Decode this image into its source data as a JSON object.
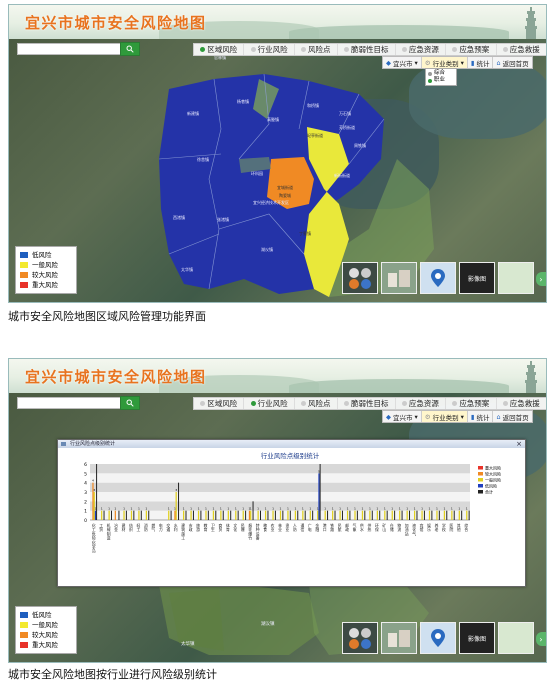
{
  "app": {
    "title": "宜兴市城市安全风险地图",
    "search_placeholder": "",
    "nav_tabs": [
      "区域风险",
      "行业风险",
      "风险点",
      "脆弱性目标",
      "应急资源",
      "应急预案",
      "应急救援"
    ],
    "toolbar": {
      "city": "宜兴市",
      "industry": "行业类别",
      "stats": "统计",
      "home": "返回首页"
    },
    "industry_dropdown": [
      "综合",
      "职业"
    ],
    "legend": [
      {
        "label": "低风险",
        "color": "#1f5fbf"
      },
      {
        "label": "一般风险",
        "color": "#f3e92f"
      },
      {
        "label": "较大风险",
        "color": "#f08a24"
      },
      {
        "label": "重大风险",
        "color": "#e8332a"
      }
    ],
    "thumbnails": [
      "",
      "",
      "",
      "影像图",
      ""
    ]
  },
  "panel1": {
    "active_tab": "区域风险",
    "caption": "城市安全风险地图区域风险管理功能界面",
    "regions": [
      "官林镇",
      "新建镇",
      "杨巷镇",
      "和桥镇",
      "万石镇",
      "周铁镇",
      "芳桥街道",
      "新街街道",
      "宜城街道",
      "屺亭街道",
      "宜兴经济技术开发区",
      "高塍镇",
      "丁蜀镇",
      "湖㳇镇",
      "张渚镇",
      "西渚镇",
      "太华镇",
      "徐舍镇",
      "环科园",
      "陶瓷城"
    ]
  },
  "panel2": {
    "active_tab": "行业风险",
    "caption": "城市安全风险地图按行业进行风险级别统计",
    "window_title": "行业风险点级别统计",
    "map_labels": [
      "湖㳇镇",
      "太华镇"
    ],
    "chart_data": {
      "type": "bar",
      "title": "行业风险点级别统计",
      "series_legend": [
        "重大风险",
        "较大风险",
        "一般风险",
        "低风险",
        "合计"
      ],
      "series_colors": [
        "#e8332a",
        "#f08a24",
        "#e0d020",
        "#1f3fbf",
        "#222222"
      ],
      "categories": [
        "化工危险化学品",
        "工贸",
        "机械制造",
        "冶金",
        "建材",
        "纺织",
        "轻工",
        "消防",
        "燃气",
        "电力",
        "交通",
        "水利",
        "建筑施工",
        "市政",
        "旅游",
        "教育",
        "卫生",
        "商贸",
        "体育",
        "文化",
        "民爆",
        "烟花爆竹",
        "特种设备",
        "粮食",
        "农业",
        "林业",
        "渔业",
        "人防",
        "通信",
        "广电",
        "金融",
        "港口",
        "铁路",
        "民航",
        "邮政",
        "气象",
        "供水",
        "供热",
        "环保",
        "矿山",
        "仓储",
        "物流",
        "加油站",
        "液化气",
        "宾馆",
        "娱乐",
        "养老",
        "学校",
        "医院",
        "其他",
        "综合"
      ],
      "series": [
        {
          "name": "重大风险",
          "values": [
            0,
            0,
            0,
            0,
            0,
            0,
            0,
            0,
            0,
            0,
            0,
            0,
            0,
            0,
            0,
            0,
            0,
            0,
            0,
            0,
            0,
            0,
            0,
            0,
            0,
            0,
            0,
            0,
            0,
            0,
            0,
            0,
            0,
            0,
            0,
            0,
            0,
            0,
            0,
            0,
            0,
            0,
            0,
            0,
            0,
            0,
            0,
            0,
            0,
            0,
            0
          ]
        },
        {
          "name": "较大风险",
          "values": [
            4,
            0,
            0,
            1,
            0,
            0,
            0,
            0,
            0,
            0,
            0,
            1,
            0,
            0,
            0,
            0,
            0,
            0,
            0,
            0,
            0,
            1,
            0,
            0,
            0,
            0,
            0,
            0,
            0,
            0,
            0,
            0,
            0,
            0,
            0,
            0,
            0,
            0,
            0,
            0,
            0,
            0,
            0,
            0,
            0,
            0,
            0,
            0,
            0,
            0,
            0
          ]
        },
        {
          "name": "一般风险",
          "values": [
            3,
            1,
            1,
            0,
            1,
            1,
            1,
            1,
            0,
            0,
            1,
            3,
            1,
            1,
            1,
            1,
            1,
            1,
            1,
            1,
            1,
            1,
            1,
            1,
            1,
            1,
            1,
            1,
            1,
            1,
            1,
            1,
            1,
            1,
            1,
            1,
            1,
            1,
            1,
            1,
            1,
            1,
            1,
            1,
            1,
            1,
            1,
            1,
            1,
            1,
            1
          ]
        },
        {
          "name": "低风险",
          "values": [
            1,
            0,
            0,
            0,
            0,
            0,
            0,
            0,
            0,
            0,
            0,
            0,
            0,
            0,
            0,
            0,
            0,
            0,
            0,
            0,
            0,
            0,
            0,
            0,
            0,
            0,
            0,
            0,
            0,
            0,
            5,
            0,
            0,
            0,
            0,
            0,
            0,
            0,
            0,
            0,
            0,
            0,
            0,
            0,
            0,
            0,
            0,
            0,
            0,
            0,
            0
          ]
        }
      ],
      "ylim": [
        0,
        6
      ]
    }
  }
}
